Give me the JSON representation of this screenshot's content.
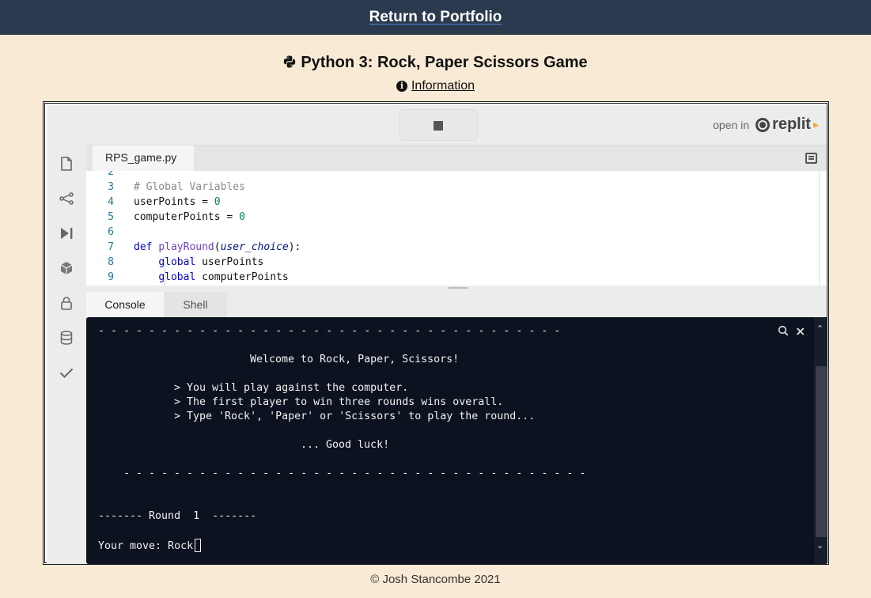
{
  "nav": {
    "link_label": "Return to Portfolio"
  },
  "page": {
    "title": "Python 3: Rock, Paper Scissors Game",
    "info_label": "Information",
    "footer": "© Josh Stancombe 2021"
  },
  "embed": {
    "open_in_label": "open in",
    "brand": "replit",
    "file_tab": "RPS_game.py",
    "console_tabs": [
      "Console",
      "Shell"
    ],
    "code_lines": [
      {
        "n": "2",
        "text": ""
      },
      {
        "n": "3",
        "text": "# Global Variables"
      },
      {
        "n": "4",
        "var": "userPoints",
        "op": " = ",
        "val": "0"
      },
      {
        "n": "5",
        "var": "computerPoints",
        "op": " = ",
        "val": "0"
      },
      {
        "n": "6",
        "text": ""
      },
      {
        "n": "7",
        "kw": "def",
        "fn": "playRound",
        "param": "user_choice"
      },
      {
        "n": "8",
        "kw": "global",
        "var": "userPoints"
      },
      {
        "n": "9",
        "kw": "global",
        "var": "computerPoints"
      }
    ],
    "terminal_lines": [
      "- - - - - - - - - - - - - - - - - - - - - - - - - - - - - - - - - - - - -",
      "Welcome to Rock, Paper, Scissors!",
      "> You will play against the computer.",
      "> The first player to win three rounds wins overall.",
      "> Type 'Rock', 'Paper' or 'Scissors' to play the round...",
      "... Good luck!",
      "- - - - - - - - - - - - - - - - - - - - - - - - - - - - - - - - - - - - -",
      "------- Round  1  -------",
      "Your move: Rock"
    ]
  },
  "colors": {
    "page_bg": "#f9ead6",
    "nav_bg": "#2b3a4e",
    "terminal_bg": "#0c1220"
  }
}
